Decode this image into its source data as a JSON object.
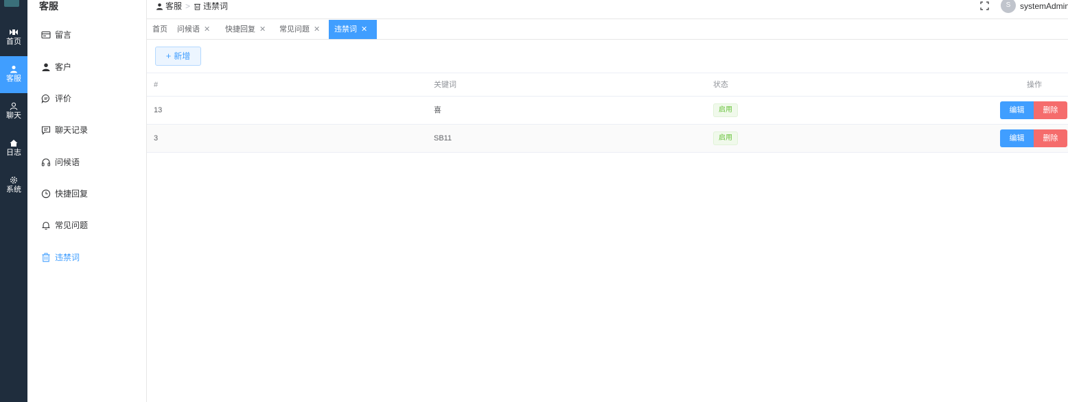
{
  "rail": {
    "items": [
      {
        "label": "首页",
        "icon": "logo-icon"
      },
      {
        "label": "客服",
        "icon": "user-icon"
      },
      {
        "label": "聊天",
        "icon": "person-outline-icon"
      },
      {
        "label": "日志",
        "icon": "home-icon"
      },
      {
        "label": "系统",
        "icon": "gear-icon"
      }
    ],
    "active_index": 1
  },
  "sidebar": {
    "title": "客服",
    "items": [
      {
        "label": "留言",
        "icon": "message-board-icon"
      },
      {
        "label": "客户",
        "icon": "user-icon"
      },
      {
        "label": "评价",
        "icon": "comment-icon"
      },
      {
        "label": "聊天记录",
        "icon": "chat-record-icon"
      },
      {
        "label": "问候语",
        "icon": "headset-icon"
      },
      {
        "label": "快捷回复",
        "icon": "clock-icon"
      },
      {
        "label": "常见问题",
        "icon": "bell-icon"
      },
      {
        "label": "违禁词",
        "icon": "trash-icon"
      }
    ],
    "active_index": 7
  },
  "header": {
    "breadcrumb": [
      "客服",
      "违禁词"
    ],
    "username": "systemAdmin",
    "avatar_initial": "S"
  },
  "tabs": [
    {
      "label": "首页",
      "closable": false
    },
    {
      "label": "问候语",
      "closable": true
    },
    {
      "label": "快捷回复",
      "closable": true
    },
    {
      "label": "常见问题",
      "closable": true
    },
    {
      "label": "违禁词",
      "closable": true,
      "active": true
    }
  ],
  "toolbar": {
    "add_label": "新增",
    "add_icon": "plus-icon"
  },
  "table": {
    "columns": [
      "#",
      "关键词",
      "状态",
      "操作"
    ],
    "rows": [
      {
        "id": "13",
        "keyword": "喜",
        "status": "启用"
      },
      {
        "id": "3",
        "keyword": "SB11",
        "status": "启用"
      }
    ],
    "edit_label": "编辑",
    "delete_label": "删除"
  },
  "colors": {
    "primary": "#409eff",
    "danger": "#f56c6c",
    "success": "#67c23a",
    "rail_bg": "#1f2d3d"
  }
}
